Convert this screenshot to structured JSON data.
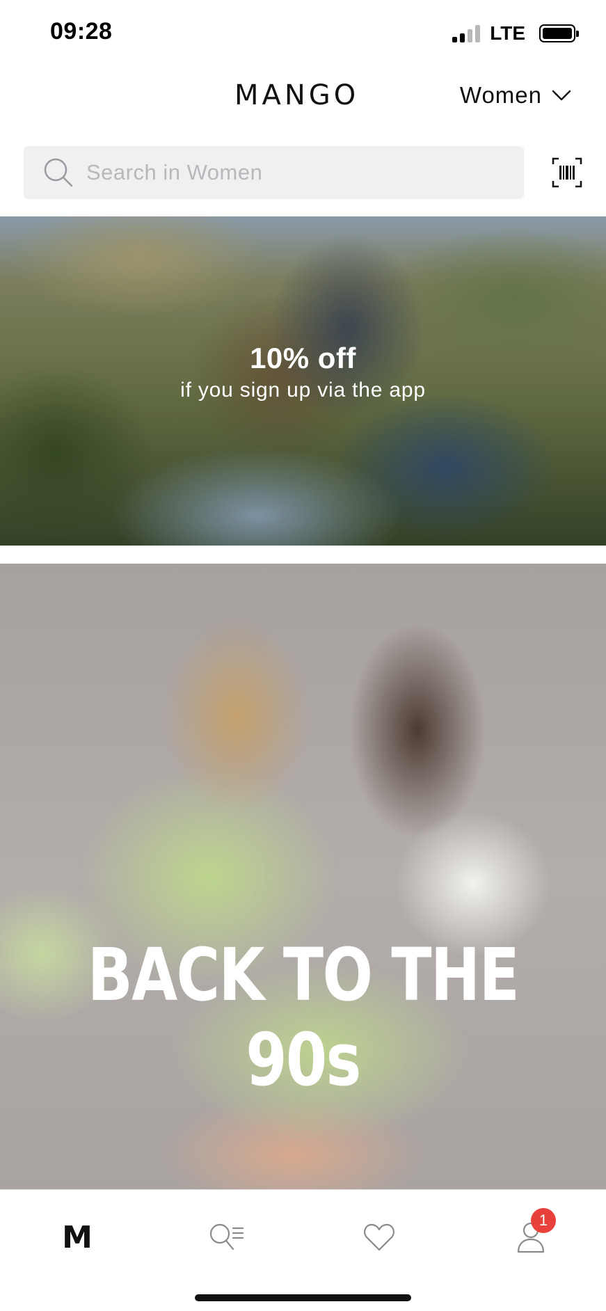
{
  "status_bar": {
    "time": "09:28",
    "network": "LTE",
    "icons": [
      "signal-icon",
      "battery-icon"
    ]
  },
  "header": {
    "logo": "MANGO",
    "section_label": "Women",
    "section_icon": "chevron-down-icon"
  },
  "search": {
    "placeholder": "Search in Women",
    "value": "",
    "icon": "search-icon",
    "scan_icon": "barcode-scan-icon"
  },
  "banners": [
    {
      "title": "10% off",
      "subtitle": "if you sign up via the app"
    },
    {
      "title": "BACK TO THE 90s"
    }
  ],
  "tab_bar": {
    "home_logo": "M",
    "icons": [
      "mango-home-icon",
      "search-list-icon",
      "heart-icon",
      "user-icon"
    ],
    "account_badge": "1",
    "badge_color": "#e8403a"
  }
}
